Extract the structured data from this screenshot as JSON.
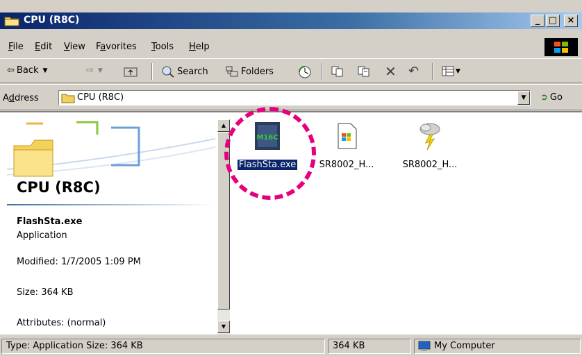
{
  "window": {
    "title": "CPU (R8C)",
    "controls": {
      "minimize": "_",
      "maximize": "□",
      "close": "×"
    }
  },
  "menu": {
    "items": [
      {
        "key": "F",
        "rest": "ile"
      },
      {
        "key": "E",
        "rest": "dit"
      },
      {
        "key": "V",
        "rest": "iew"
      },
      {
        "pre": "F",
        "key": "a",
        "rest": "vorites"
      },
      {
        "key": "T",
        "rest": "ools"
      },
      {
        "key": "H",
        "rest": "elp"
      }
    ]
  },
  "toolbar": {
    "back_label": "Back",
    "search_label": "Search",
    "folders_label": "Folders"
  },
  "address": {
    "label_pre": "A",
    "label_key": "d",
    "label_rest": "dress",
    "value": "CPU (R8C)",
    "go_label": "Go"
  },
  "left_pane": {
    "title": "CPU (R8C)",
    "selected_name": "FlashSta.exe",
    "selected_type": "Application",
    "modified": "Modified: 1/7/2005 1:09 PM",
    "size": "Size: 364 KB",
    "attributes": "Attributes: (normal)"
  },
  "files": [
    {
      "name": "FlashSta.exe",
      "icon": "m16c-chip-icon",
      "selected": true
    },
    {
      "name": "SR8002_H...",
      "icon": "windows-help-icon",
      "selected": false
    },
    {
      "name": "SR8002_H...",
      "icon": "weather-cloud-icon",
      "selected": false
    }
  ],
  "icon_text": "M16C",
  "status": {
    "info": "Type: Application Size: 364 KB",
    "size": "364 KB",
    "zone": "My Computer"
  },
  "colors": {
    "titlebar": "#0a246a",
    "selection": "#0a246a",
    "highlight_ring": "#e6007e",
    "chrome": "#d4d0c8"
  }
}
